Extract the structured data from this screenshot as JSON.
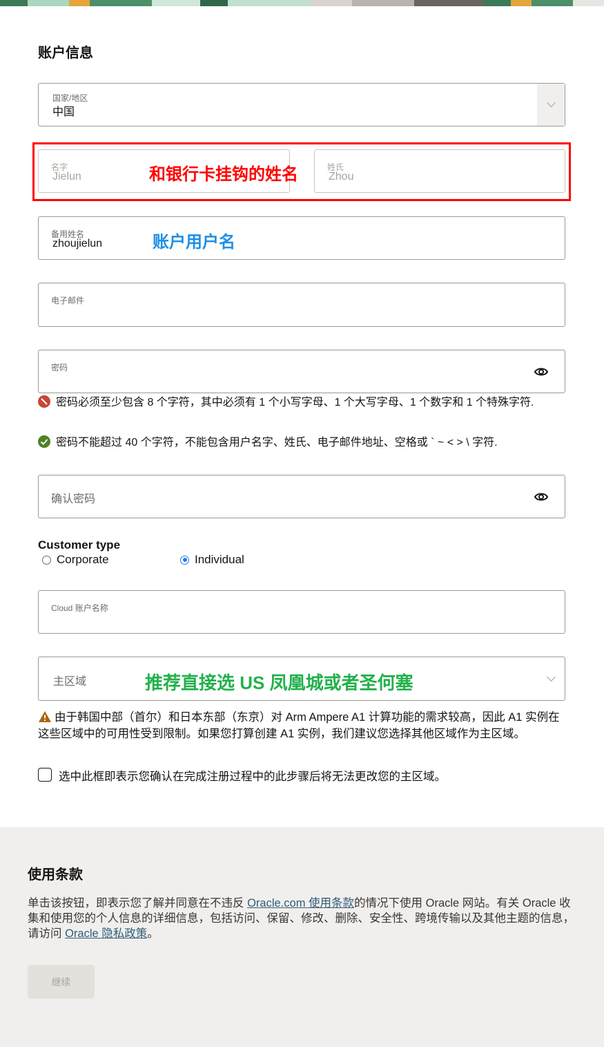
{
  "account_section": {
    "title": "账户信息",
    "country": {
      "label": "国家/地区",
      "value": "中国"
    },
    "first_name": {
      "label": "名字",
      "placeholder": "Jielun"
    },
    "last_name": {
      "label": "姓氏",
      "placeholder": "Zhou"
    },
    "alt_name": {
      "label": "备用姓名",
      "value": "zhoujielun"
    },
    "email": {
      "label": "电子邮件"
    },
    "password": {
      "label": "密码",
      "rules": [
        {
          "status": "error",
          "text": "密码必须至少包含 8 个字符，其中必须有 1 个小写字母、1 个大写字母、1 个数字和 1 个特殊字符."
        },
        {
          "status": "ok",
          "text": "密码不能超过 40 个字符，不能包含用户名字、姓氏、电子邮件地址、空格或 ` ~ < > \\ 字符."
        }
      ]
    },
    "confirm_password": {
      "placeholder": "确认密码"
    },
    "customer_type": {
      "label": "Customer type",
      "options": [
        {
          "label": "Corporate",
          "selected": false
        },
        {
          "label": "Individual",
          "selected": true
        }
      ]
    },
    "cloud_account": {
      "label": "Cloud 账户名称"
    },
    "home_region": {
      "placeholder": "主区域"
    },
    "region_warning": "由于韩国中部（首尔）和日本东部（东京）对 Arm Ampere A1 计算功能的需求较高，因此 A1 实例在这些区域中的可用性受到限制。如果您打算创建 A1 实例，我们建议您选择其他区域作为主区域。",
    "confirm_checkbox": {
      "label": "选中此框即表示您确认在完成注册过程中的此步骤后将无法更改您的主区域。",
      "checked": false
    }
  },
  "annotations": {
    "name_note": "和银行卡挂钩的姓名",
    "username_note": "账户用户名",
    "region_note": "推荐直接选 US 凤凰城或者圣何塞"
  },
  "terms": {
    "title": "使用条款",
    "text_1": "单击该按钮，即表示您了解并同意在不违反 ",
    "link_1": "Oracle.com 使用条款",
    "text_2": "的情况下使用 Oracle 网站。有关 Oracle 收集和使用您的个人信息的详细信息，包括访问、保留、修改、删除、安全性、跨境传输以及其他主题的信息，请访问 ",
    "link_2": "Oracle 隐私政策",
    "text_3": "。",
    "continue_label": "继续"
  },
  "colors": {
    "annotation_red": "#ff0000",
    "annotation_blue": "#1e8fe6",
    "annotation_green": "#22b14c",
    "radio_selected": "#227ae6",
    "link": "#315d79"
  }
}
